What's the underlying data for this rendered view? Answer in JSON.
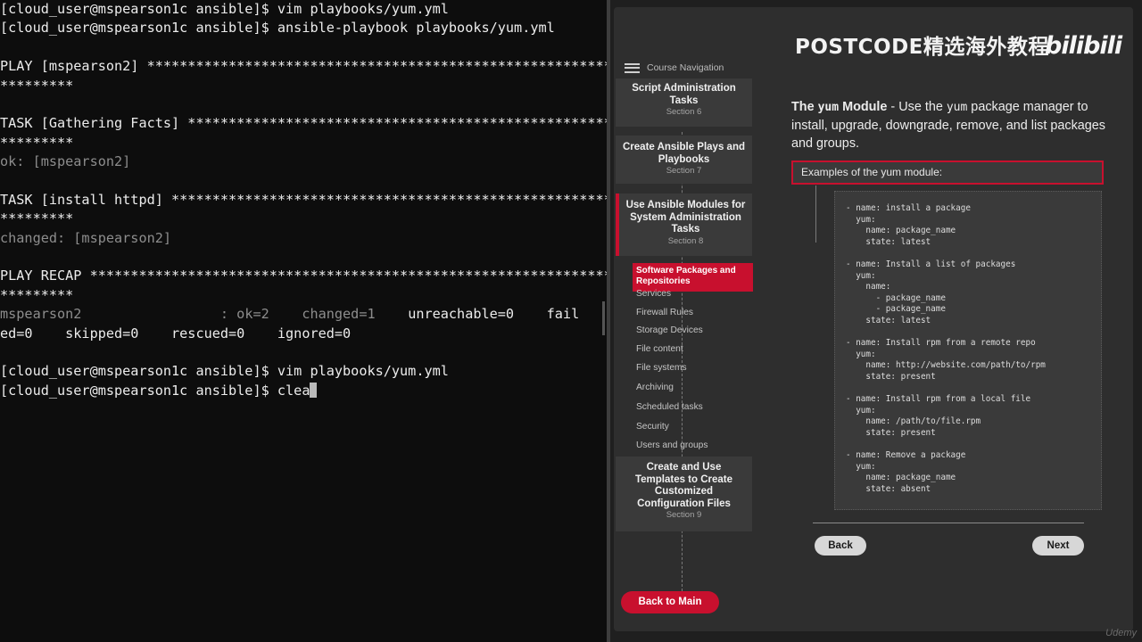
{
  "terminal": {
    "lines": [
      {
        "text": "[cloud_user@mspearson1c ansible]$ vim playbooks/yum.yml",
        "dim": false
      },
      {
        "text": "[cloud_user@mspearson1c ansible]$ ansible-playbook playbooks/yum.yml",
        "dim": false
      },
      {
        "text": "",
        "dim": false
      },
      {
        "text": "PLAY [mspearson2] **************************************************************",
        "dim": false
      },
      {
        "text": "*********",
        "dim": false
      },
      {
        "text": "",
        "dim": false
      },
      {
        "text": "TASK [Gathering Facts] *********************************************************",
        "dim": false
      },
      {
        "text": "*********",
        "dim": false
      },
      {
        "text": "ok: [mspearson2]",
        "dim": true
      },
      {
        "text": "",
        "dim": false
      },
      {
        "text": "TASK [install httpd] ***********************************************************",
        "dim": false
      },
      {
        "text": "*********",
        "dim": false
      },
      {
        "text": "changed: [mspearson2]",
        "dim": true
      },
      {
        "text": "",
        "dim": false
      },
      {
        "text": "PLAY RECAP *********************************************************************",
        "dim": false
      },
      {
        "text": "*********",
        "dim": false
      },
      {
        "text": "",
        "dim": false,
        "recap": true
      },
      {
        "text": "ed=0    skipped=0    rescued=0    ignored=0",
        "dim": false
      },
      {
        "text": "",
        "dim": false
      },
      {
        "text": "[cloud_user@mspearson1c ansible]$ vim playbooks/yum.yml",
        "dim": false
      },
      {
        "text": "",
        "dim": false,
        "prompt": true
      }
    ],
    "recap": {
      "host": "mspearson2",
      "sep": "                 : ",
      "ok": "ok=2",
      "changed": "    changed=1",
      "rest": "    unreachable=0    fail"
    },
    "prompt": "[cloud_user@mspearson1c ansible]$ ",
    "typed": "clea"
  },
  "watermark": {
    "text": "POSTCODE精选海外教程",
    "logo": "bilibili"
  },
  "nav": {
    "title": "Course Navigation",
    "sections": [
      {
        "title": "Script Administration Tasks",
        "sub": "Section 6"
      },
      {
        "title": "Create Ansible Plays and Playbooks",
        "sub": "Section 7"
      },
      {
        "title": "Use Ansible Modules for System Administration Tasks",
        "sub": "Section 8"
      },
      {
        "title": "Create and Use Templates to Create Customized Configuration Files",
        "sub": "Section 9"
      }
    ],
    "active_item": "Software Packages and Repositories",
    "items": [
      "Services",
      "Firewall Rules",
      "Storage Devices",
      "File content",
      "File systems",
      "Archiving",
      "Scheduled tasks",
      "Security",
      "Users and groups"
    ],
    "back_main": "Back to Main"
  },
  "content": {
    "heading_pre": "The ",
    "heading_mono": "yum",
    "heading_post": " Module",
    "desc_pre": " - Use the ",
    "desc_mono": "yum",
    "desc_post": " package manager to install, upgrade, downgrade, remove, and list packages and groups.",
    "examples_label": "Examples of the yum module:",
    "code": "- name: install a package\n  yum:\n    name: package_name\n    state: latest\n\n- name: Install a list of packages\n  yum:\n    name:\n      - package_name\n      - package_name\n    state: latest\n\n- name: Install rpm from a remote repo\n  yum:\n    name: http://website.com/path/to/rpm\n    state: present\n\n- name: Install rpm from a local file\n  yum:\n    name: /path/to/file.rpm\n    state: present\n\n- name: Remove a package\n  yum:\n    name: package_name\n    state: absent",
    "back": "Back",
    "next": "Next"
  },
  "corner_mark": "Udemy",
  "colors": {
    "accent": "#c8102e",
    "terminal_bg": "#0d0d0d",
    "panel_bg": "#2e2e2e",
    "nav_block": "#3a3a3a"
  }
}
